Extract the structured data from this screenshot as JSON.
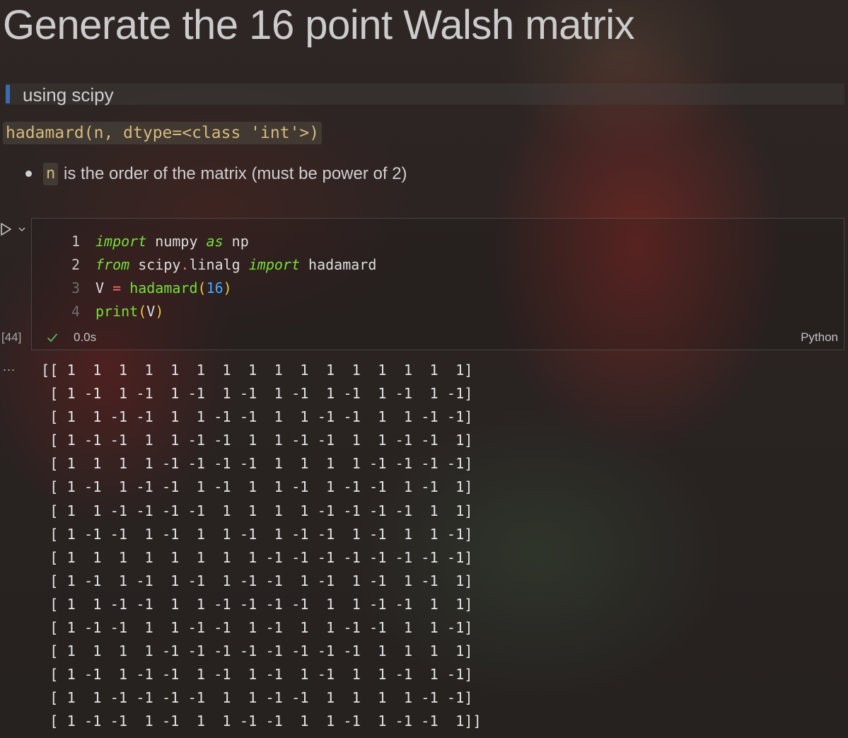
{
  "markdown": {
    "title": "Generate the 16 point Walsh matrix",
    "quote": "using scipy",
    "signature": "hadamard(n, dtype=<class 'int'>)",
    "bullet_code": "n",
    "bullet_text": "is the order of the matrix (must be power of 2)"
  },
  "cell": {
    "code_lines": [
      {
        "number": "1",
        "tokens": [
          {
            "t": "import",
            "c": "kw"
          },
          {
            "t": " numpy ",
            "c": ""
          },
          {
            "t": "as",
            "c": "kw"
          },
          {
            "t": " np",
            "c": ""
          }
        ]
      },
      {
        "number": "2",
        "tokens": [
          {
            "t": "from",
            "c": "kw"
          },
          {
            "t": " scipy",
            "c": ""
          },
          {
            "t": ".",
            "c": "op"
          },
          {
            "t": "linalg ",
            "c": ""
          },
          {
            "t": "import",
            "c": "kw"
          },
          {
            "t": " hadamard",
            "c": ""
          }
        ]
      },
      {
        "number": "3",
        "tokens": [
          {
            "t": "V ",
            "c": ""
          },
          {
            "t": "=",
            "c": "op"
          },
          {
            "t": " ",
            "c": ""
          },
          {
            "t": "hadamard",
            "c": "fn"
          },
          {
            "t": "(",
            "c": "paren"
          },
          {
            "t": "16",
            "c": "num"
          },
          {
            "t": ")",
            "c": "paren"
          }
        ]
      },
      {
        "number": "4",
        "tokens": [
          {
            "t": "print",
            "c": "fn"
          },
          {
            "t": "(",
            "c": "paren"
          },
          {
            "t": "V",
            "c": ""
          },
          {
            "t": ")",
            "c": "paren"
          }
        ]
      }
    ],
    "execution_count": "[44]",
    "status_icon": "check-icon",
    "duration": "0.0s",
    "language": "Python",
    "run_icon": "play-icon",
    "menu_icon": "chevron-down-icon"
  },
  "output": {
    "more_icon": "ellipsis-icon",
    "more_label": "...",
    "lines": [
      "[[ 1  1  1  1  1  1  1  1  1  1  1  1  1  1  1  1]",
      " [ 1 -1  1 -1  1 -1  1 -1  1 -1  1 -1  1 -1  1 -1]",
      " [ 1  1 -1 -1  1  1 -1 -1  1  1 -1 -1  1  1 -1 -1]",
      " [ 1 -1 -1  1  1 -1 -1  1  1 -1 -1  1  1 -1 -1  1]",
      " [ 1  1  1  1 -1 -1 -1 -1  1  1  1  1 -1 -1 -1 -1]",
      " [ 1 -1  1 -1 -1  1 -1  1  1 -1  1 -1 -1  1 -1  1]",
      " [ 1  1 -1 -1 -1 -1  1  1  1  1 -1 -1 -1 -1  1  1]",
      " [ 1 -1 -1  1 -1  1  1 -1  1 -1 -1  1 -1  1  1 -1]",
      " [ 1  1  1  1  1  1  1  1 -1 -1 -1 -1 -1 -1 -1 -1]",
      " [ 1 -1  1 -1  1 -1  1 -1 -1  1 -1  1 -1  1 -1  1]",
      " [ 1  1 -1 -1  1  1 -1 -1 -1 -1  1  1 -1 -1  1  1]",
      " [ 1 -1 -1  1  1 -1 -1  1 -1  1  1 -1 -1  1  1 -1]",
      " [ 1  1  1  1 -1 -1 -1 -1 -1 -1 -1 -1  1  1  1  1]",
      " [ 1 -1  1 -1 -1  1 -1  1 -1  1 -1  1  1 -1  1 -1]",
      " [ 1  1 -1 -1 -1 -1  1  1 -1 -1  1  1  1  1 -1 -1]",
      " [ 1 -1 -1  1 -1  1  1 -1 -1  1  1 -1  1 -1 -1  1]]"
    ]
  }
}
